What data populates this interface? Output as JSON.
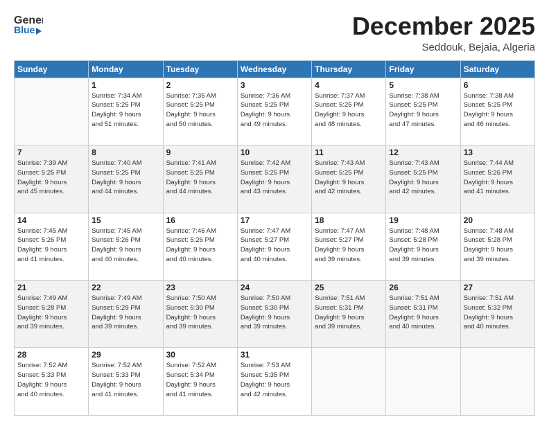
{
  "logo": {
    "general": "General",
    "blue": "Blue"
  },
  "header": {
    "month": "December 2025",
    "location": "Seddouk, Bejaia, Algeria"
  },
  "days_of_week": [
    "Sunday",
    "Monday",
    "Tuesday",
    "Wednesday",
    "Thursday",
    "Friday",
    "Saturday"
  ],
  "weeks": [
    [
      {
        "day": "",
        "info": ""
      },
      {
        "day": "1",
        "info": "Sunrise: 7:34 AM\nSunset: 5:25 PM\nDaylight: 9 hours\nand 51 minutes."
      },
      {
        "day": "2",
        "info": "Sunrise: 7:35 AM\nSunset: 5:25 PM\nDaylight: 9 hours\nand 50 minutes."
      },
      {
        "day": "3",
        "info": "Sunrise: 7:36 AM\nSunset: 5:25 PM\nDaylight: 9 hours\nand 49 minutes."
      },
      {
        "day": "4",
        "info": "Sunrise: 7:37 AM\nSunset: 5:25 PM\nDaylight: 9 hours\nand 48 minutes."
      },
      {
        "day": "5",
        "info": "Sunrise: 7:38 AM\nSunset: 5:25 PM\nDaylight: 9 hours\nand 47 minutes."
      },
      {
        "day": "6",
        "info": "Sunrise: 7:38 AM\nSunset: 5:25 PM\nDaylight: 9 hours\nand 46 minutes."
      }
    ],
    [
      {
        "day": "7",
        "info": "Sunrise: 7:39 AM\nSunset: 5:25 PM\nDaylight: 9 hours\nand 45 minutes."
      },
      {
        "day": "8",
        "info": "Sunrise: 7:40 AM\nSunset: 5:25 PM\nDaylight: 9 hours\nand 44 minutes."
      },
      {
        "day": "9",
        "info": "Sunrise: 7:41 AM\nSunset: 5:25 PM\nDaylight: 9 hours\nand 44 minutes."
      },
      {
        "day": "10",
        "info": "Sunrise: 7:42 AM\nSunset: 5:25 PM\nDaylight: 9 hours\nand 43 minutes."
      },
      {
        "day": "11",
        "info": "Sunrise: 7:43 AM\nSunset: 5:25 PM\nDaylight: 9 hours\nand 42 minutes."
      },
      {
        "day": "12",
        "info": "Sunrise: 7:43 AM\nSunset: 5:25 PM\nDaylight: 9 hours\nand 42 minutes."
      },
      {
        "day": "13",
        "info": "Sunrise: 7:44 AM\nSunset: 5:26 PM\nDaylight: 9 hours\nand 41 minutes."
      }
    ],
    [
      {
        "day": "14",
        "info": "Sunrise: 7:45 AM\nSunset: 5:26 PM\nDaylight: 9 hours\nand 41 minutes."
      },
      {
        "day": "15",
        "info": "Sunrise: 7:45 AM\nSunset: 5:26 PM\nDaylight: 9 hours\nand 40 minutes."
      },
      {
        "day": "16",
        "info": "Sunrise: 7:46 AM\nSunset: 5:26 PM\nDaylight: 9 hours\nand 40 minutes."
      },
      {
        "day": "17",
        "info": "Sunrise: 7:47 AM\nSunset: 5:27 PM\nDaylight: 9 hours\nand 40 minutes."
      },
      {
        "day": "18",
        "info": "Sunrise: 7:47 AM\nSunset: 5:27 PM\nDaylight: 9 hours\nand 39 minutes."
      },
      {
        "day": "19",
        "info": "Sunrise: 7:48 AM\nSunset: 5:28 PM\nDaylight: 9 hours\nand 39 minutes."
      },
      {
        "day": "20",
        "info": "Sunrise: 7:48 AM\nSunset: 5:28 PM\nDaylight: 9 hours\nand 39 minutes."
      }
    ],
    [
      {
        "day": "21",
        "info": "Sunrise: 7:49 AM\nSunset: 5:28 PM\nDaylight: 9 hours\nand 39 minutes."
      },
      {
        "day": "22",
        "info": "Sunrise: 7:49 AM\nSunset: 5:29 PM\nDaylight: 9 hours\nand 39 minutes."
      },
      {
        "day": "23",
        "info": "Sunrise: 7:50 AM\nSunset: 5:30 PM\nDaylight: 9 hours\nand 39 minutes."
      },
      {
        "day": "24",
        "info": "Sunrise: 7:50 AM\nSunset: 5:30 PM\nDaylight: 9 hours\nand 39 minutes."
      },
      {
        "day": "25",
        "info": "Sunrise: 7:51 AM\nSunset: 5:31 PM\nDaylight: 9 hours\nand 39 minutes."
      },
      {
        "day": "26",
        "info": "Sunrise: 7:51 AM\nSunset: 5:31 PM\nDaylight: 9 hours\nand 40 minutes."
      },
      {
        "day": "27",
        "info": "Sunrise: 7:51 AM\nSunset: 5:32 PM\nDaylight: 9 hours\nand 40 minutes."
      }
    ],
    [
      {
        "day": "28",
        "info": "Sunrise: 7:52 AM\nSunset: 5:33 PM\nDaylight: 9 hours\nand 40 minutes."
      },
      {
        "day": "29",
        "info": "Sunrise: 7:52 AM\nSunset: 5:33 PM\nDaylight: 9 hours\nand 41 minutes."
      },
      {
        "day": "30",
        "info": "Sunrise: 7:52 AM\nSunset: 5:34 PM\nDaylight: 9 hours\nand 41 minutes."
      },
      {
        "day": "31",
        "info": "Sunrise: 7:53 AM\nSunset: 5:35 PM\nDaylight: 9 hours\nand 42 minutes."
      },
      {
        "day": "",
        "info": ""
      },
      {
        "day": "",
        "info": ""
      },
      {
        "day": "",
        "info": ""
      }
    ]
  ]
}
